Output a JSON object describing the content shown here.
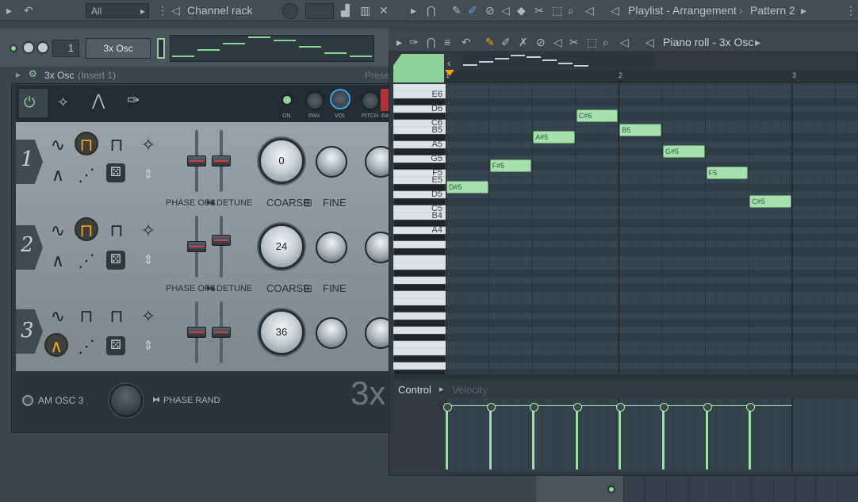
{
  "top_bar": {
    "filter": "All",
    "channel_rack_title": "Channel rack",
    "playlist_title": "Playlist - Arrangement",
    "pattern": "Pattern 2"
  },
  "channel_rack": {
    "channel_number": "1",
    "channel_name": "3x Osc"
  },
  "osc_window": {
    "title": "3x Osc",
    "insert": "(Insert 1)",
    "preset": "Prese",
    "controls": [
      "ON",
      "PAN",
      "VOL",
      "PITCH",
      "RA"
    ],
    "rows": [
      {
        "num": "1",
        "coarse": "0",
        "phase_label": "PHASE OFS",
        "detune_label": "DETUNE",
        "coarse_label": "COARSE",
        "fine_label": "FINE"
      },
      {
        "num": "2",
        "coarse": "24",
        "phase_label": "PHASE OFS",
        "detune_label": "DETUNE",
        "coarse_label": "COARSE",
        "fine_label": "FINE"
      },
      {
        "num": "3",
        "coarse": "36"
      }
    ],
    "am_label": "AM OSC 3",
    "phase_rand_label": "PHASE RAND",
    "big_logo": "3x"
  },
  "piano_roll": {
    "title": "Piano roll - 3x Osc",
    "ruler": [
      "1",
      "2",
      "3"
    ],
    "keys": [
      "E6",
      "D6",
      "C6",
      "B5",
      "A5",
      "G5",
      "F5",
      "E5",
      "D5",
      "C5",
      "B4",
      "A4"
    ],
    "notes": [
      {
        "label": "D#5",
        "step": 0,
        "pitch": "D#5"
      },
      {
        "label": "F#5",
        "step": 1,
        "pitch": "F#5"
      },
      {
        "label": "A#5",
        "step": 2,
        "pitch": "A#5"
      },
      {
        "label": "C#6",
        "step": 3,
        "pitch": "C#6"
      },
      {
        "label": "B5",
        "step": 4,
        "pitch": "B5"
      },
      {
        "label": "G#5",
        "step": 5,
        "pitch": "G#5"
      },
      {
        "label": "F5",
        "step": 6,
        "pitch": "F5"
      },
      {
        "label": "C#5",
        "step": 7,
        "pitch": "C#5"
      }
    ],
    "control_label": "Control",
    "control_value": "Velocity"
  },
  "colors": {
    "accent": "#8fd39a",
    "note": "#a7dfae",
    "selected_wave": "#f0a024"
  }
}
